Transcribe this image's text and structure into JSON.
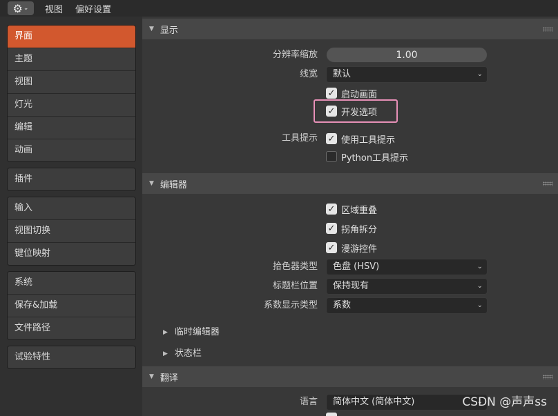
{
  "topbar": {
    "gear_icon": "⚙",
    "menu": [
      "视图",
      "偏好设置"
    ]
  },
  "sidebar": {
    "groups": [
      [
        "界面",
        "主题",
        "视图",
        "灯光",
        "编辑",
        "动画"
      ],
      [
        "插件"
      ],
      [
        "输入",
        "视图切换",
        "键位映射"
      ],
      [
        "系统",
        "保存&加载",
        "文件路径"
      ],
      [
        "试验特性"
      ]
    ],
    "active": "界面"
  },
  "display": {
    "title": "显示",
    "resolution_label": "分辨率缩放",
    "resolution_value": "1.00",
    "line_width_label": "线宽",
    "line_width_value": "默认",
    "splash_label": "启动画面",
    "dev_options_label": "开发选项",
    "tooltips_label": "工具提示",
    "user_tooltips_label": "使用工具提示",
    "python_tooltips_label": "Python工具提示"
  },
  "editors": {
    "title": "编辑器",
    "region_overlap_label": "区域重叠",
    "corner_split_label": "拐角拆分",
    "navigation_controls_label": "漫游控件",
    "color_picker_label": "拾色器类型",
    "color_picker_value": "色盘 (HSV)",
    "header_position_label": "标题栏位置",
    "header_position_value": "保持现有",
    "factor_display_label": "系数显示类型",
    "factor_display_value": "系数",
    "temp_editors_label": "临时编辑器",
    "status_bar_label": "状态栏"
  },
  "translation": {
    "title": "翻译",
    "language_label": "语言",
    "language_value": "简体中文 (简体中文)"
  },
  "watermark": "CSDN @声声ss",
  "colors": {
    "accent": "#d2582e",
    "highlight_box": "#e890b8"
  }
}
